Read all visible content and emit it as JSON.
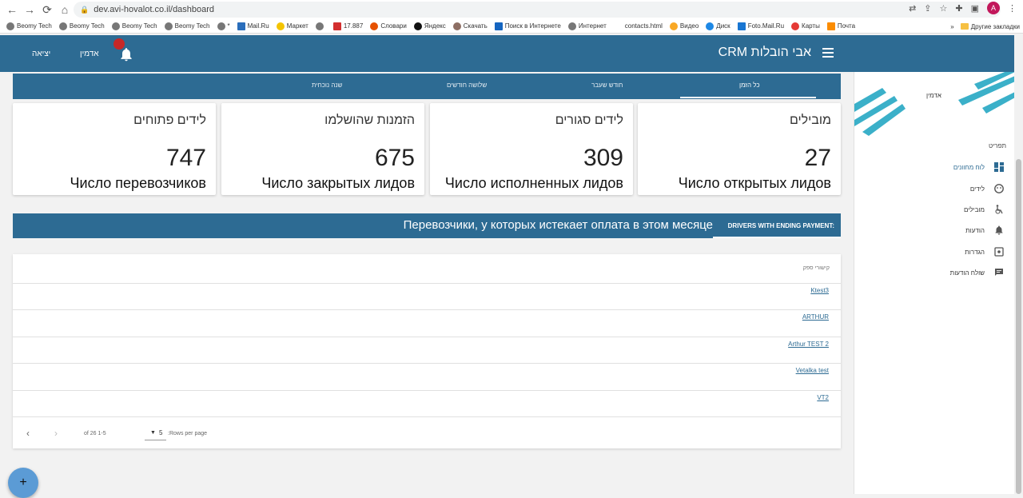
{
  "browser": {
    "url": "dev.avi-hovalot.co.il/dashboard",
    "profile_initial": "A",
    "bookmarks": [
      "Beomy Tech",
      "Beomy Tech",
      "Beomy Tech",
      "Beomy Tech",
      "*",
      "Mail.Ru",
      "Маркет",
      "",
      "17.887",
      "Словари",
      "Яндекс",
      "Скачать",
      "Поиск в Интернете",
      "Интернет",
      "contacts.html",
      "Видео",
      "Диск",
      "Foto.Mail.Ru",
      "Карты",
      "Почта"
    ],
    "bookmarks_more": "»",
    "other_bookmarks": "Другие закладки"
  },
  "header": {
    "title": "CRM אבי הובלות",
    "logout": "יציאה",
    "user": "אדמין"
  },
  "sidebar": {
    "admin": "אדמין",
    "menu_title": "תפריט",
    "items": [
      {
        "label": "לוח מחוונים",
        "active": true
      },
      {
        "label": "לידים",
        "active": false
      },
      {
        "label": "מובילים",
        "active": false
      },
      {
        "label": "הודעות",
        "active": false
      },
      {
        "label": "הגדרות",
        "active": false
      },
      {
        "label": "שולח הודעות",
        "active": false
      }
    ]
  },
  "tabs": [
    "כל הזמן",
    "חודש שעבר",
    "שלושה חודשים",
    "שנה נוכחית"
  ],
  "cards": [
    {
      "title": "מובילים",
      "value": "27",
      "subtitle": "Число открытых лидов"
    },
    {
      "title": "לידים סגורים",
      "value": "309",
      "subtitle": "Число исполненных лидов"
    },
    {
      "title": "הזמנות שהושלמו",
      "value": "675",
      "subtitle": "Число закрытых лидов"
    },
    {
      "title": "לידים פתוחים",
      "value": "747",
      "subtitle": "Число перевозчиков"
    }
  ],
  "banner": {
    "en": "DRIVERS WITH ENDING PAYMENT:",
    "ru": "Перевозчики, у которых истекает оплата в этом месяце"
  },
  "table": {
    "header": "קישורי ספק",
    "rows": [
      "Ktest3",
      "ARTHUR",
      "Arthur TEST 2",
      "Vetalka test",
      "VT2"
    ],
    "pagination": {
      "range": "of 26 1-5",
      "rows_per_page_value": "5",
      "rows_per_page_label": ":Rows per page"
    }
  },
  "fab": "+",
  "colors": {
    "primary": "#2d6b93",
    "badge": "#c62828",
    "fab": "#5b9bd5"
  }
}
